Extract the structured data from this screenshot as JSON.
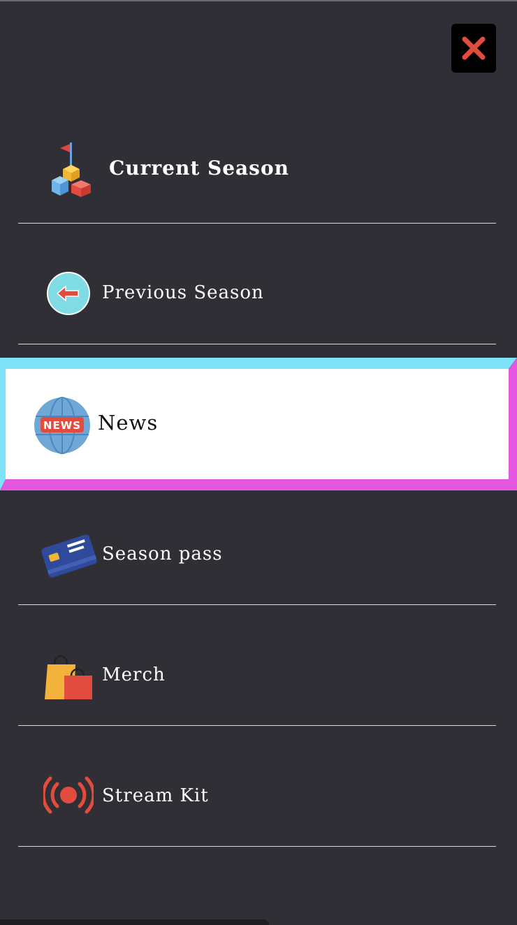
{
  "close": {
    "label": "Close menu",
    "icon": "close-x-icon",
    "color": "#e24c3f"
  },
  "menu": {
    "items": [
      {
        "label": "Current Season",
        "icon": "podium-blocks-icon",
        "active": false
      },
      {
        "label": "Previous Season",
        "icon": "back-arrow-circle-icon",
        "active": false
      },
      {
        "label": "News",
        "icon": "news-globe-icon",
        "active": true
      },
      {
        "label": "Season pass",
        "icon": "credit-card-icon",
        "active": false
      },
      {
        "label": "Merch",
        "icon": "shopping-bags-icon",
        "active": false
      },
      {
        "label": "Stream Kit",
        "icon": "live-broadcast-icon",
        "active": false
      }
    ]
  },
  "colors": {
    "background": "#302f36",
    "active_frame_cyan": "#7fe3f7",
    "active_frame_magenta": "#e455e0",
    "text": "#ffffff"
  }
}
